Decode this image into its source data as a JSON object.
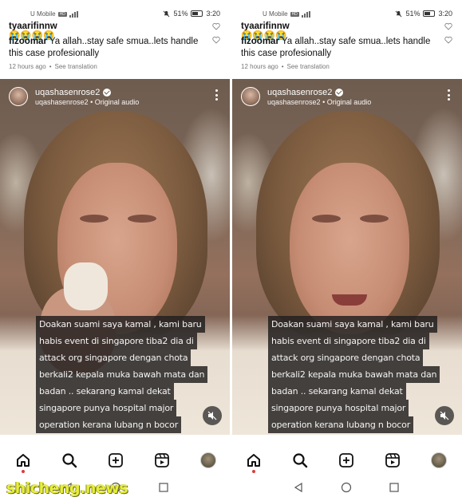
{
  "status_bar": {
    "carrier": "U Mobile",
    "network_tag": "HD",
    "battery": "51%",
    "battery_level": 0.51,
    "time": "3:20"
  },
  "comments": [
    {
      "user": "tyaarifinnw",
      "text": "😭😭😭😭"
    },
    {
      "user": "fizoomar",
      "text": "Ya allah..stay safe smua..lets handle this case profesionally"
    }
  ],
  "comment_meta": {
    "time_ago": "12 hours ago",
    "translation": "See translation"
  },
  "post": {
    "username": "uqashasenrose2",
    "subtitle_user": "uqashasenrose2",
    "audio": "Original audio",
    "caption_lines": [
      "Doakan suami saya kamal , kami baru",
      "habis event di singapore tiba2 dia di",
      "attack org singapore dengan chota",
      "berkali2 kepala muka bawah mata dan",
      "badan .. sekarang kamal dekat",
      "singapore punya hospital major",
      "operation kerana lubang n bocor"
    ]
  },
  "bottom_nav": {
    "home": "home-icon",
    "search": "search-icon",
    "create": "plus-square-icon",
    "reels": "reels-icon",
    "profile": "avatar"
  },
  "watermark": "shicheng.news",
  "colors": {
    "caption_bg": "#1e1c1c",
    "notification_dot": "#e03a3a",
    "watermark": "#e6ee3a"
  }
}
